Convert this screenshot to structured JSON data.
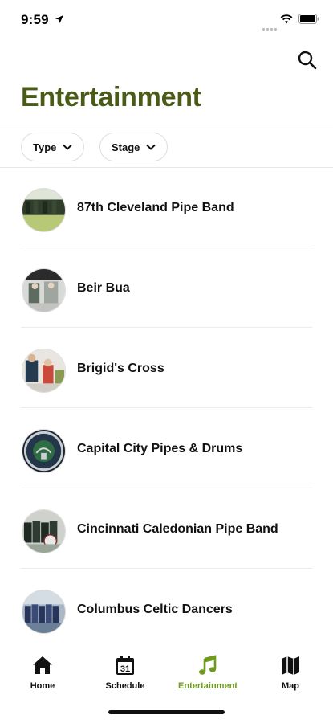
{
  "status_bar": {
    "time": "9:59"
  },
  "header": {
    "title": "Entertainment"
  },
  "filters": [
    {
      "label": "Type"
    },
    {
      "label": "Stage"
    }
  ],
  "performers": [
    {
      "name": "87th Cleveland Pipe Band"
    },
    {
      "name": "Beir Bua"
    },
    {
      "name": "Brigid's Cross"
    },
    {
      "name": "Capital City Pipes & Drums"
    },
    {
      "name": "Cincinnati Caledonian Pipe Band"
    },
    {
      "name": "Columbus Celtic Dancers"
    }
  ],
  "tabs": [
    {
      "label": "Home",
      "icon": "house-icon"
    },
    {
      "label": "Schedule",
      "icon": "calendar-icon",
      "badge": "31"
    },
    {
      "label": "Entertainment",
      "icon": "music-note-icon",
      "active": true
    },
    {
      "label": "Map",
      "icon": "map-icon"
    }
  ],
  "colors": {
    "accent_title": "#4a5a17",
    "active_tab": "#6f9a1e"
  }
}
